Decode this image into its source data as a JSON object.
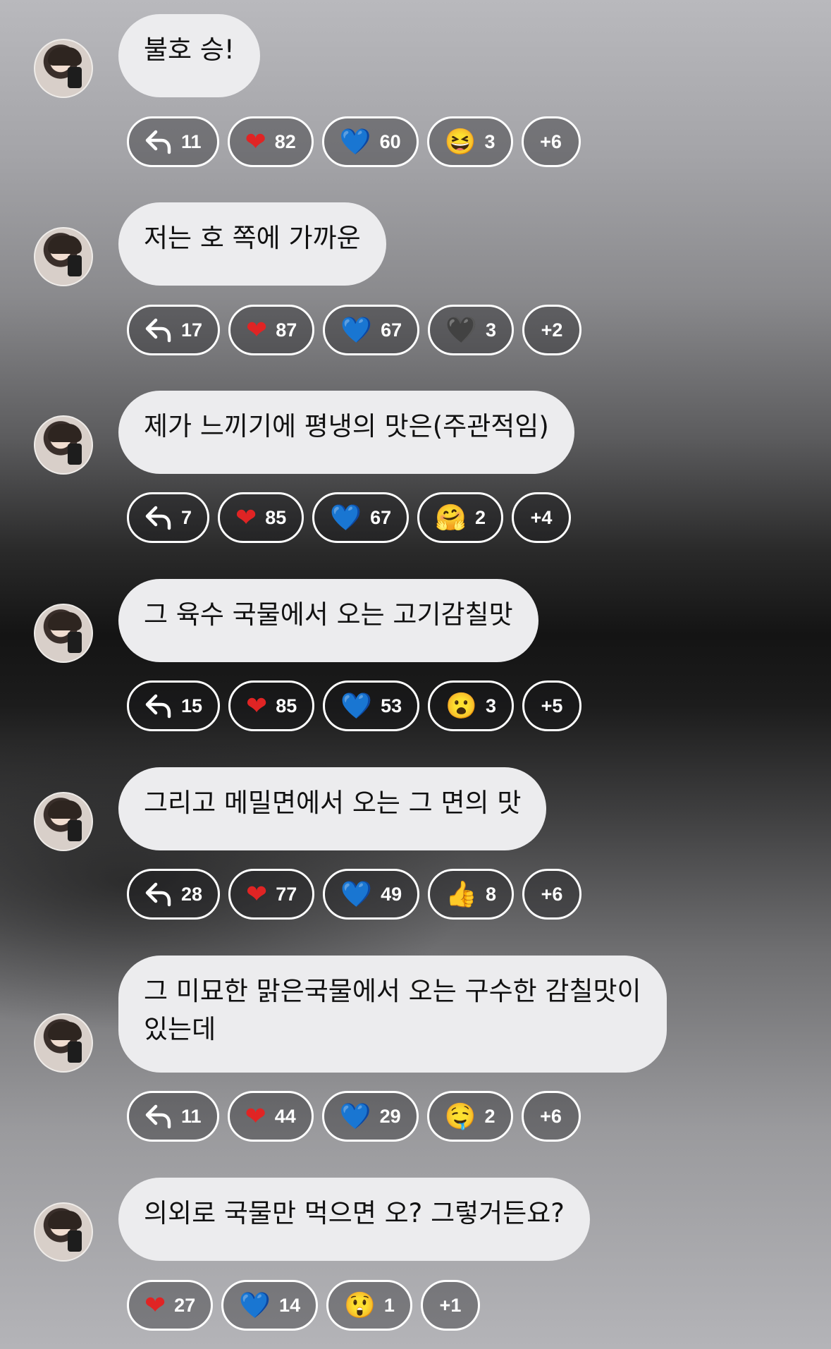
{
  "messages": [
    {
      "text": "불호 승!",
      "reactions": [
        {
          "type": "reply-icon",
          "count": "11"
        },
        {
          "type": "red-heart-icon",
          "glyph": "❤",
          "count": "82"
        },
        {
          "type": "blue-heart-icon",
          "glyph": "💙",
          "count": "60"
        },
        {
          "type": "laughing-face-icon",
          "glyph": "😆",
          "count": "3"
        },
        {
          "type": "more",
          "count": "+6"
        }
      ]
    },
    {
      "text": "저는 호 쪽에 가까운",
      "reactions": [
        {
          "type": "reply-icon",
          "count": "17"
        },
        {
          "type": "red-heart-icon",
          "glyph": "❤",
          "count": "87"
        },
        {
          "type": "blue-heart-icon",
          "glyph": "💙",
          "count": "67"
        },
        {
          "type": "black-heart-icon",
          "glyph": "🖤",
          "count": "3"
        },
        {
          "type": "more",
          "count": "+2"
        }
      ]
    },
    {
      "text": "제가 느끼기에 평냉의 맛은(주관적임)",
      "reactions": [
        {
          "type": "reply-icon",
          "count": "7"
        },
        {
          "type": "red-heart-icon",
          "glyph": "❤",
          "count": "85"
        },
        {
          "type": "blue-heart-icon",
          "glyph": "💙",
          "count": "67"
        },
        {
          "type": "hugging-face-icon",
          "glyph": "🤗",
          "count": "2"
        },
        {
          "type": "more",
          "count": "+4"
        }
      ]
    },
    {
      "text": "그 육수 국물에서 오는 고기감칠맛",
      "reactions": [
        {
          "type": "reply-icon",
          "count": "15"
        },
        {
          "type": "red-heart-icon",
          "glyph": "❤",
          "count": "85"
        },
        {
          "type": "blue-heart-icon",
          "glyph": "💙",
          "count": "53"
        },
        {
          "type": "surprised-face-icon",
          "glyph": "😮",
          "count": "3"
        },
        {
          "type": "more",
          "count": "+5"
        }
      ]
    },
    {
      "text": "그리고 메밀면에서 오는 그 면의 맛",
      "reactions": [
        {
          "type": "reply-icon",
          "count": "28"
        },
        {
          "type": "red-heart-icon",
          "glyph": "❤",
          "count": "77"
        },
        {
          "type": "blue-heart-icon",
          "glyph": "💙",
          "count": "49"
        },
        {
          "type": "thumbs-up-icon",
          "glyph": "👍",
          "count": "8"
        },
        {
          "type": "more",
          "count": "+6"
        }
      ]
    },
    {
      "text": "그 미묘한 맑은국물에서 오는 구수한 감칠맛이\n있는데",
      "reactions": [
        {
          "type": "reply-icon",
          "count": "11"
        },
        {
          "type": "red-heart-icon",
          "glyph": "❤",
          "count": "44"
        },
        {
          "type": "blue-heart-icon",
          "glyph": "💙",
          "count": "29"
        },
        {
          "type": "smiling-face-icon",
          "glyph": "🤤",
          "count": "2"
        },
        {
          "type": "more",
          "count": "+6"
        }
      ]
    },
    {
      "text": "의외로 국물만 먹으면 오? 그렇거든요?",
      "reactions": [
        {
          "type": "red-heart-icon",
          "glyph": "❤",
          "count": "27"
        },
        {
          "type": "blue-heart-icon",
          "glyph": "💙",
          "count": "14"
        },
        {
          "type": "astonished-face-icon",
          "glyph": "😲",
          "count": "1"
        },
        {
          "type": "more",
          "count": "+1"
        }
      ]
    }
  ]
}
